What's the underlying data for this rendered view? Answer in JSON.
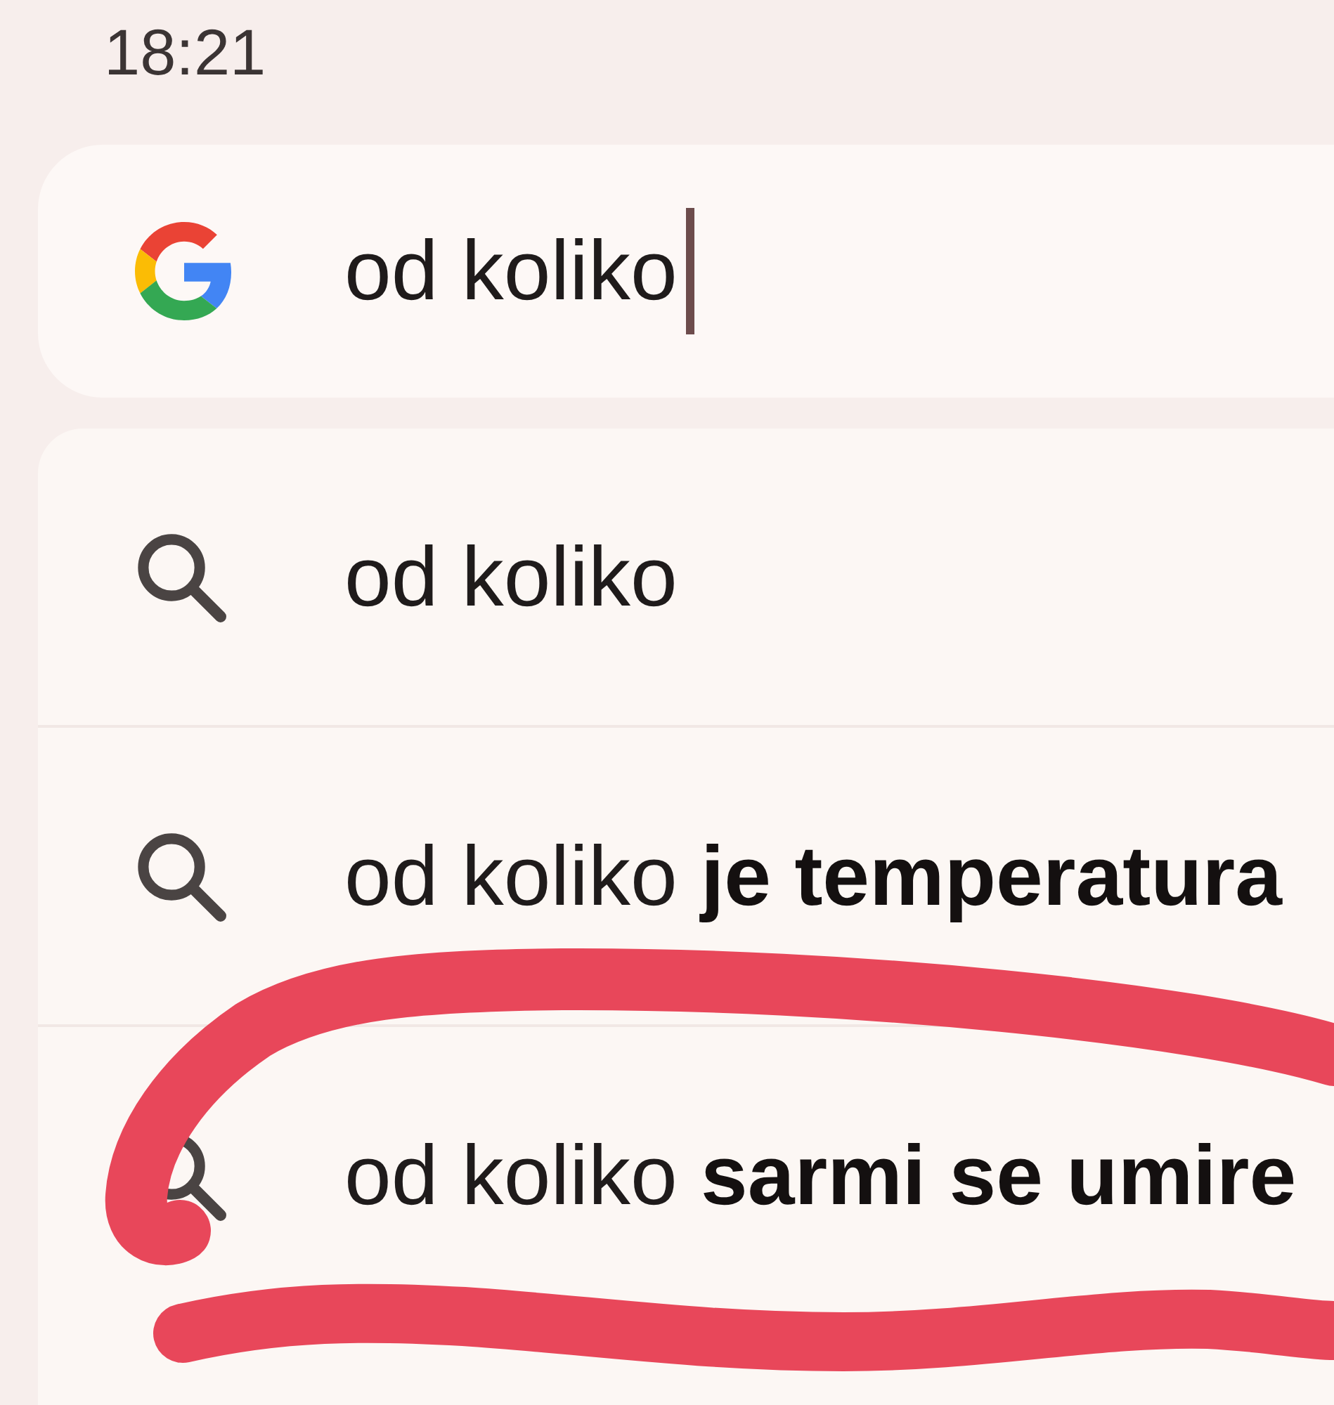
{
  "status_bar": {
    "time": "18:21"
  },
  "search_bar": {
    "value": "od koliko",
    "focused": true
  },
  "suggestions": [
    {
      "text": "od koliko",
      "highlighted": false
    },
    {
      "text": "od koliko **je temperatura**",
      "highlighted": false
    },
    {
      "text": "od koliko **sarmi se umire**",
      "highlighted": true
    }
  ]
}
